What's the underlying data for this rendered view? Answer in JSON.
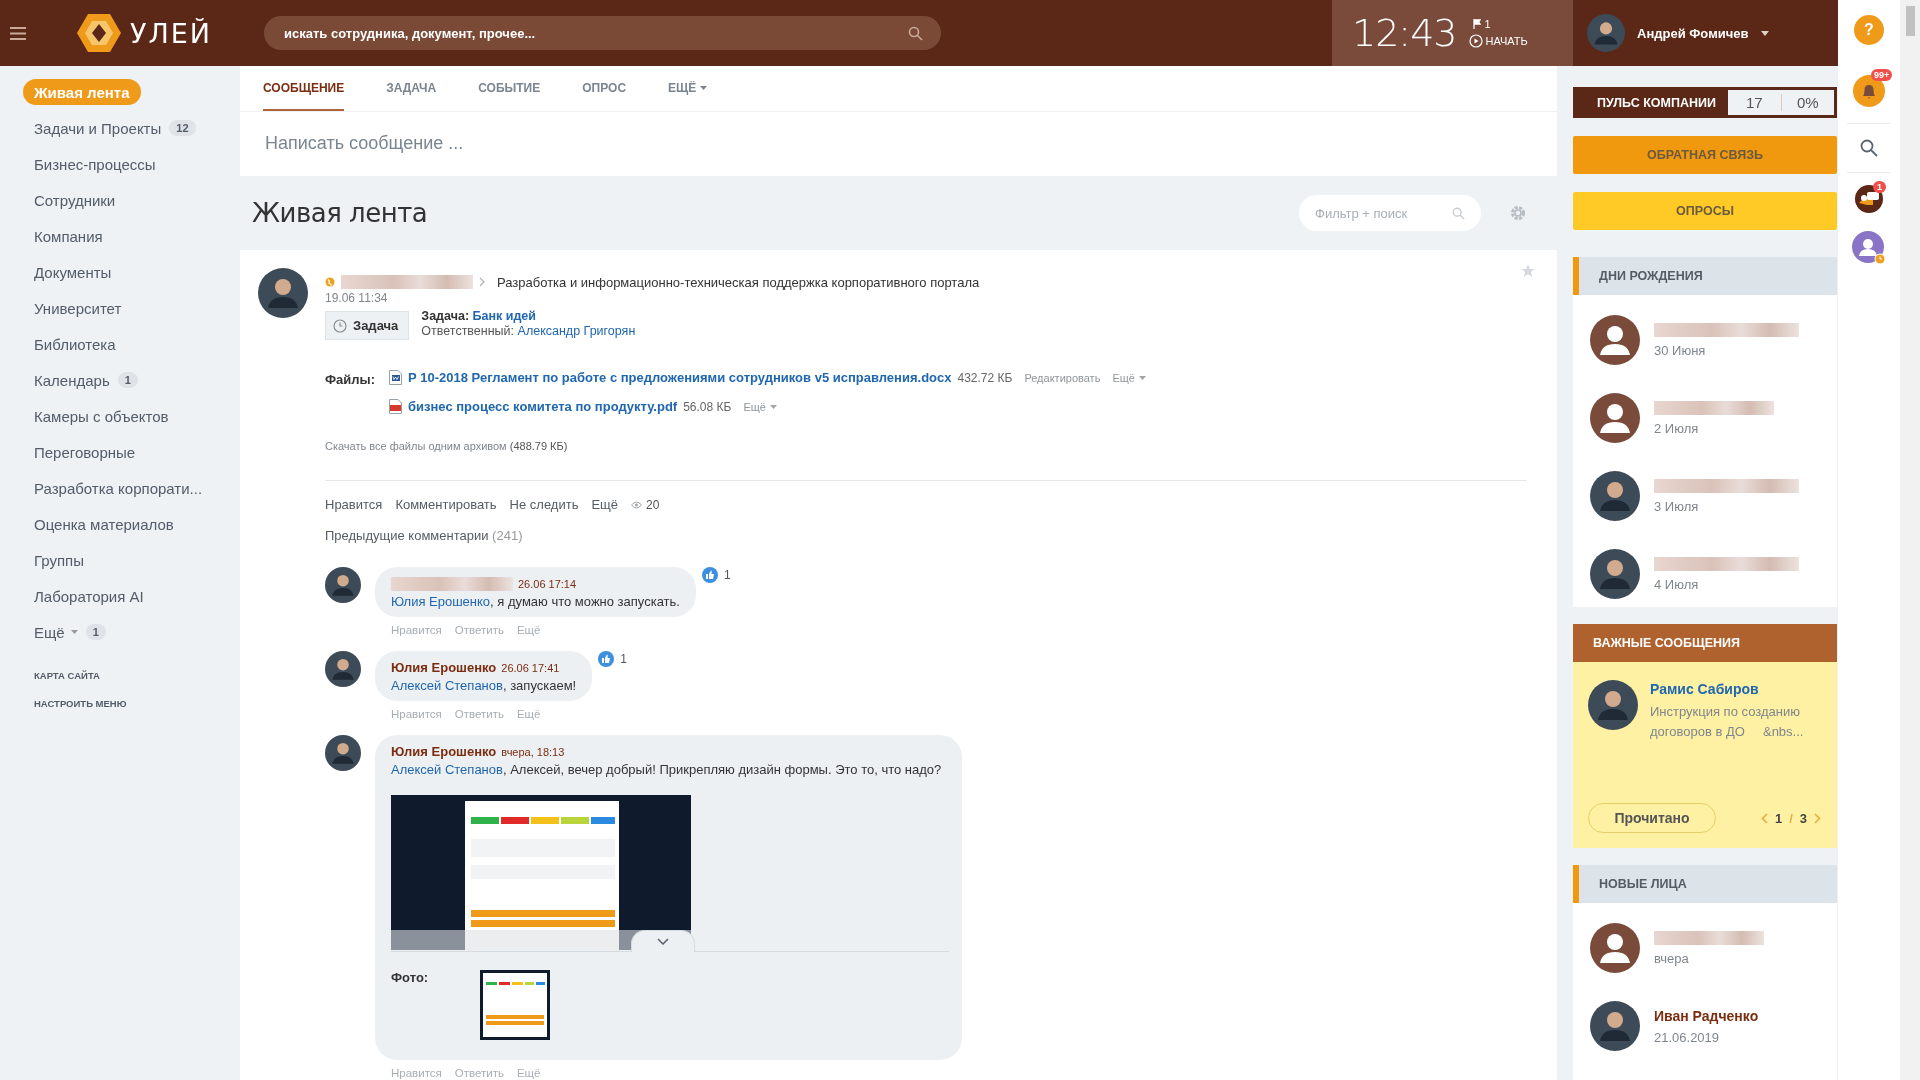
{
  "topbar": {
    "logo_text": "УЛЕЙ",
    "search_placeholder": "искать сотрудника, документ, прочее...",
    "clock": "12:43",
    "flag_count": "1",
    "start_label": "НАЧАТЬ",
    "user_name": "Андрей Фомичев"
  },
  "sidebar": {
    "items": [
      {
        "label": "Живая лента",
        "selected": true
      },
      {
        "label": "Задачи и Проекты",
        "count": "12",
        "selected": false
      },
      {
        "label": "Бизнес-процессы",
        "selected": false
      },
      {
        "label": "Сотрудники",
        "selected": false
      },
      {
        "label": "Компания",
        "selected": false
      },
      {
        "label": "Документы",
        "selected": false
      },
      {
        "label": "Университет",
        "selected": false
      },
      {
        "label": "Библиотека",
        "selected": false
      },
      {
        "label": "Календарь",
        "count": "1",
        "selected": false
      },
      {
        "label": "Камеры с объектов",
        "selected": false
      },
      {
        "label": "Переговорные",
        "selected": false
      },
      {
        "label": "Разработка корпорати...",
        "selected": false
      },
      {
        "label": "Оценка материалов",
        "selected": false
      },
      {
        "label": "Группы",
        "selected": false
      },
      {
        "label": "Лаборатория AI",
        "selected": false
      },
      {
        "label": "Ещё",
        "count": "1",
        "dropdown": true,
        "selected": false
      }
    ],
    "footer_links": [
      "КАРТА САЙТА",
      "НАСТРОИТЬ МЕНЮ"
    ]
  },
  "composer": {
    "tabs": [
      {
        "label": "СООБЩЕНИЕ",
        "selected": true
      },
      {
        "label": "ЗАДАЧА",
        "selected": false
      },
      {
        "label": "СОБЫТИЕ",
        "selected": false
      },
      {
        "label": "ОПРОС",
        "selected": false
      },
      {
        "label": "ЕЩЁ",
        "dropdown": true,
        "selected": false
      }
    ],
    "placeholder": "Написать сообщение ..."
  },
  "feed": {
    "title": "Живая лента",
    "filter_placeholder": "Фильтр + поиск"
  },
  "post": {
    "destination": "Разработка и информационно-техническая поддержка корпоративного портала",
    "date": "19.06 11:34",
    "badge": "Задача",
    "task_label": "Задача:",
    "task_link": "Банк идей",
    "responsible_label": "Ответственный:",
    "responsible_link": "Александр Григорян",
    "files_label": "Файлы:",
    "files": [
      {
        "kind": "docx",
        "name": "Р 10-2018 Регламент по работе с предложениями сотрудников v5 исправления.docx",
        "size": "432.72 КБ",
        "edit": "Редактировать",
        "more": "Ещё"
      },
      {
        "kind": "pdf",
        "name": "бизнес процесс комитета по продукту.pdf",
        "size": "56.08 КБ",
        "more": "Ещё"
      }
    ],
    "download_all": "Скачать все файлы одним архивом",
    "archive_size": "(488.79 КБ)",
    "actions": [
      "Нравится",
      "Комментировать",
      "Не следить",
      "Ещё"
    ],
    "views": "20",
    "prev_comments": "Предыдущие комментарии",
    "prev_count": "(241)",
    "comments": [
      {
        "time": "26.06 17:14",
        "mention": "Юлия Ерошенко",
        "text": ", я думаю что можно запускать.",
        "likes": "1",
        "actions": [
          "Нравится",
          "Ответить",
          "Ещё"
        ]
      },
      {
        "author": "Юлия Ерошенко",
        "time": "26.06 17:41",
        "mention": "Алексей Степанов",
        "text": ", запускаем!",
        "likes": "1",
        "actions": [
          "Нравится",
          "Ответить",
          "Ещё"
        ]
      },
      {
        "author": "Юлия Ерошенко",
        "time": "вчера, 18:13",
        "mention": "Алексей Степанов",
        "text": ", Алексей, вечер добрый! Прикрепляю дизайн формы. Это то, что надо?",
        "attachment": true,
        "photo_label": "Фото:",
        "actions": [
          "Нравится",
          "Ответить",
          "Ещё"
        ]
      }
    ]
  },
  "right": {
    "pulse": {
      "label": "ПУЛЬС КОМПАНИИ",
      "count": "17",
      "percent": "0%"
    },
    "buttons": [
      {
        "label": "ОБРАТНАЯ СВЯЗЬ",
        "kind": "feedback"
      },
      {
        "label": "ОПРОСЫ",
        "kind": "polls"
      }
    ],
    "birthdays": {
      "title": "ДНИ РОЖДЕНИЯ",
      "people": [
        {
          "date": "30 Июня",
          "kind": "placeholder"
        },
        {
          "date": "2 Июля",
          "kind": "placeholder"
        },
        {
          "date": "3 Июля",
          "kind": "photo"
        },
        {
          "date": "4 Июля",
          "kind": "photo"
        }
      ]
    },
    "important": {
      "title": "ВАЖНЫЕ СООБЩЕНИЯ",
      "author": "Рамис Сабиров",
      "text": "Инструкция по созданию договоров в ДО     &nbs...",
      "button": "Прочитано",
      "page": "1",
      "separator": "/",
      "total": "3"
    },
    "new_faces": {
      "title": "НОВЫЕ ЛИЦА",
      "people": [
        {
          "date": "вчера",
          "kind": "placeholder"
        },
        {
          "name": "Иван Радченко",
          "date": "21.06.2019",
          "kind": "photo"
        }
      ]
    }
  },
  "strip": {
    "help": "?",
    "notifications": "99+",
    "chat": "1"
  }
}
